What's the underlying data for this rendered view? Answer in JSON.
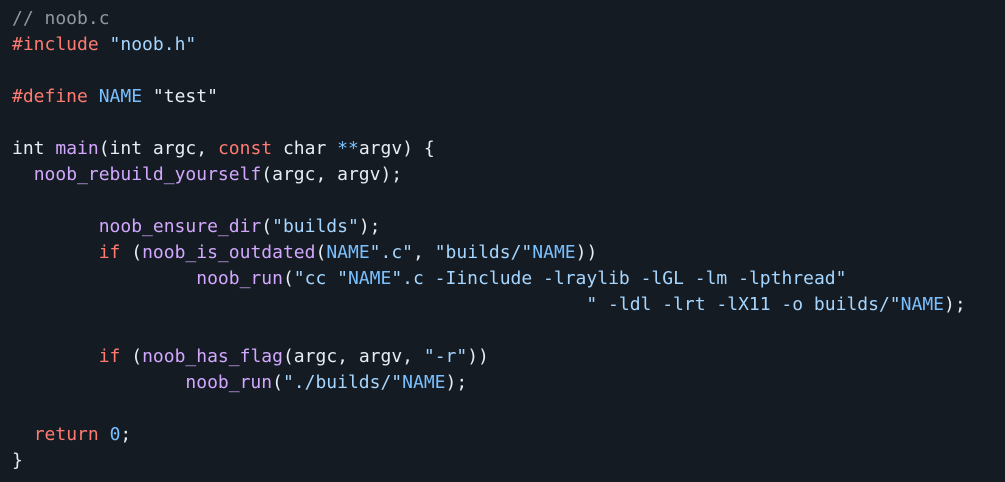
{
  "file_comment": "// noob.c",
  "colors": {
    "background": "#151b23",
    "plain": "#e6edf3",
    "comment": "#9198a1",
    "keyword": "#ff7b72",
    "string": "#a5d6ff",
    "function": "#d2a8ff",
    "constant": "#79c0ff"
  },
  "lines": [
    [
      {
        "t": "// noob.c",
        "k": "comment"
      }
    ],
    [
      {
        "t": "#include",
        "k": "keyword"
      },
      {
        "t": " ",
        "k": "plain"
      },
      {
        "t": "\"noob.h\"",
        "k": "string"
      }
    ],
    [],
    [
      {
        "t": "#define",
        "k": "keyword"
      },
      {
        "t": " ",
        "k": "plain"
      },
      {
        "t": "NAME",
        "k": "const"
      },
      {
        "t": " \"test\"",
        "k": "plain"
      }
    ],
    [],
    [
      {
        "t": "int ",
        "k": "plain"
      },
      {
        "t": "main",
        "k": "func"
      },
      {
        "t": "(int argc, ",
        "k": "plain"
      },
      {
        "t": "const",
        "k": "keyword"
      },
      {
        "t": " char ",
        "k": "plain"
      },
      {
        "t": "**",
        "k": "const"
      },
      {
        "t": "argv) {",
        "k": "plain"
      }
    ],
    [
      {
        "t": "  ",
        "k": "plain"
      },
      {
        "t": "noob_rebuild_yourself",
        "k": "func"
      },
      {
        "t": "(argc, argv);",
        "k": "plain"
      }
    ],
    [],
    [
      {
        "t": "        ",
        "k": "plain"
      },
      {
        "t": "noob_ensure_dir",
        "k": "func"
      },
      {
        "t": "(",
        "k": "plain"
      },
      {
        "t": "\"builds\"",
        "k": "string"
      },
      {
        "t": ");",
        "k": "plain"
      }
    ],
    [
      {
        "t": "        ",
        "k": "plain"
      },
      {
        "t": "if",
        "k": "keyword"
      },
      {
        "t": " (",
        "k": "plain"
      },
      {
        "t": "noob_is_outdated",
        "k": "func"
      },
      {
        "t": "(",
        "k": "plain"
      },
      {
        "t": "NAME",
        "k": "const"
      },
      {
        "t": "\".c\"",
        "k": "string"
      },
      {
        "t": ", ",
        "k": "plain"
      },
      {
        "t": "\"builds/\"",
        "k": "string"
      },
      {
        "t": "NAME",
        "k": "const"
      },
      {
        "t": "))",
        "k": "plain"
      }
    ],
    [
      {
        "t": "                 ",
        "k": "plain"
      },
      {
        "t": "noob_run",
        "k": "func"
      },
      {
        "t": "(",
        "k": "plain"
      },
      {
        "t": "\"cc \"",
        "k": "string"
      },
      {
        "t": "NAME",
        "k": "const"
      },
      {
        "t": "\".c -Iinclude -lraylib -lGL -lm -lpthread\"",
        "k": "string"
      }
    ],
    [
      {
        "t": "                                                     ",
        "k": "plain"
      },
      {
        "t": "\" -ldl -lrt -lX11 -o builds/\"",
        "k": "string"
      },
      {
        "t": "NAME",
        "k": "const"
      },
      {
        "t": ");",
        "k": "plain"
      }
    ],
    [],
    [
      {
        "t": "        ",
        "k": "plain"
      },
      {
        "t": "if",
        "k": "keyword"
      },
      {
        "t": " (",
        "k": "plain"
      },
      {
        "t": "noob_has_flag",
        "k": "func"
      },
      {
        "t": "(argc, argv, ",
        "k": "plain"
      },
      {
        "t": "\"-r\"",
        "k": "string"
      },
      {
        "t": "))",
        "k": "plain"
      }
    ],
    [
      {
        "t": "                ",
        "k": "plain"
      },
      {
        "t": "noob_run",
        "k": "func"
      },
      {
        "t": "(",
        "k": "plain"
      },
      {
        "t": "\"./builds/\"",
        "k": "string"
      },
      {
        "t": "NAME",
        "k": "const"
      },
      {
        "t": ");",
        "k": "plain"
      }
    ],
    [],
    [
      {
        "t": "  ",
        "k": "plain"
      },
      {
        "t": "return",
        "k": "keyword"
      },
      {
        "t": " ",
        "k": "plain"
      },
      {
        "t": "0",
        "k": "const"
      },
      {
        "t": ";",
        "k": "plain"
      }
    ],
    [
      {
        "t": "}",
        "k": "plain"
      }
    ]
  ]
}
